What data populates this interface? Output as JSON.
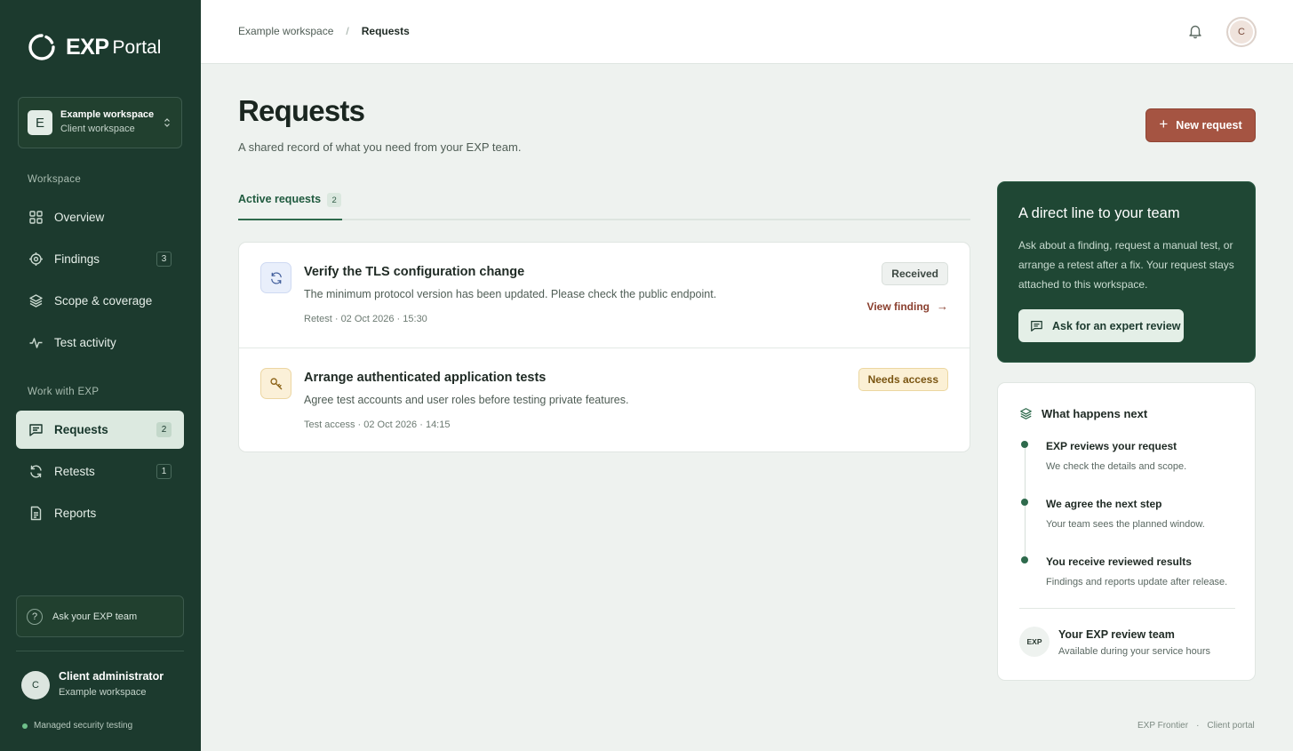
{
  "brand": {
    "name_bold": "EXP",
    "name_light": "Portal"
  },
  "workspace_switcher": {
    "initial": "E",
    "name": "Example workspace",
    "subtitle": "Client workspace",
    "icon": "chevron-updown-icon"
  },
  "sidebar": {
    "workspace_label": "Workspace",
    "workspace_items": [
      {
        "label": "Overview",
        "icon": "grid-icon"
      },
      {
        "label": "Findings",
        "icon": "target-icon",
        "count": "3"
      },
      {
        "label": "Scope & coverage",
        "icon": "layers-icon"
      },
      {
        "label": "Test activity",
        "icon": "activity-icon"
      }
    ],
    "work_label": "Work with EXP",
    "work_items": [
      {
        "label": "Requests",
        "icon": "message-icon",
        "count": "2",
        "active": true
      },
      {
        "label": "Retests",
        "icon": "refresh-icon",
        "count": "1"
      },
      {
        "label": "Reports",
        "icon": "document-icon"
      }
    ],
    "ask_team": "Ask your EXP team",
    "user": {
      "initial": "C",
      "name": "Client administrator",
      "workspace": "Example workspace"
    },
    "managed": "Managed security testing"
  },
  "topbar": {
    "breadcrumb": [
      "Example workspace",
      "Requests"
    ],
    "separator": "/",
    "avatar_initial": "C"
  },
  "main": {
    "title": "Requests",
    "subtitle": "A shared record of what you need from your EXP team.",
    "new_request": "New request",
    "tabs": [
      {
        "label": "Active requests",
        "count": "2"
      }
    ],
    "requests": [
      {
        "title": "Verify the TLS configuration change",
        "description": "The minimum protocol version has been updated. Please check the public endpoint.",
        "meta": "Retest · 02 Oct 2026 · 15:30",
        "status": "Received",
        "link": "View finding",
        "icon": "refresh-icon"
      },
      {
        "title": "Arrange authenticated application tests",
        "description": "Agree test accounts and user roles before testing private features.",
        "meta": "Test access · 02 Oct 2026 · 14:15",
        "status": "Needs access",
        "icon": "key-icon"
      }
    ]
  },
  "cta": {
    "title": "A direct line to your team",
    "body": "Ask about a finding, request a manual test, or arrange a retest after a fix. Your request stays attached to this workspace.",
    "button": "Ask for an expert review"
  },
  "next": {
    "title": "What happens next",
    "steps": [
      {
        "title": "EXP reviews your request",
        "desc": "We check the details and scope."
      },
      {
        "title": "We agree the next step",
        "desc": "Your team sees the planned window."
      },
      {
        "title": "You receive reviewed results",
        "desc": "Findings and reports update after release."
      }
    ],
    "team": {
      "avatar": "EXP",
      "name": "Your EXP review team",
      "sub": "Available during your service hours"
    }
  },
  "footer": {
    "left": "EXP Frontier",
    "separator": "·",
    "right": "Client portal"
  },
  "colors": {
    "sidebar": "#1c3a2e",
    "accent": "#a55442",
    "cta": "#1f4734",
    "active_nav": "#dce9e0"
  }
}
